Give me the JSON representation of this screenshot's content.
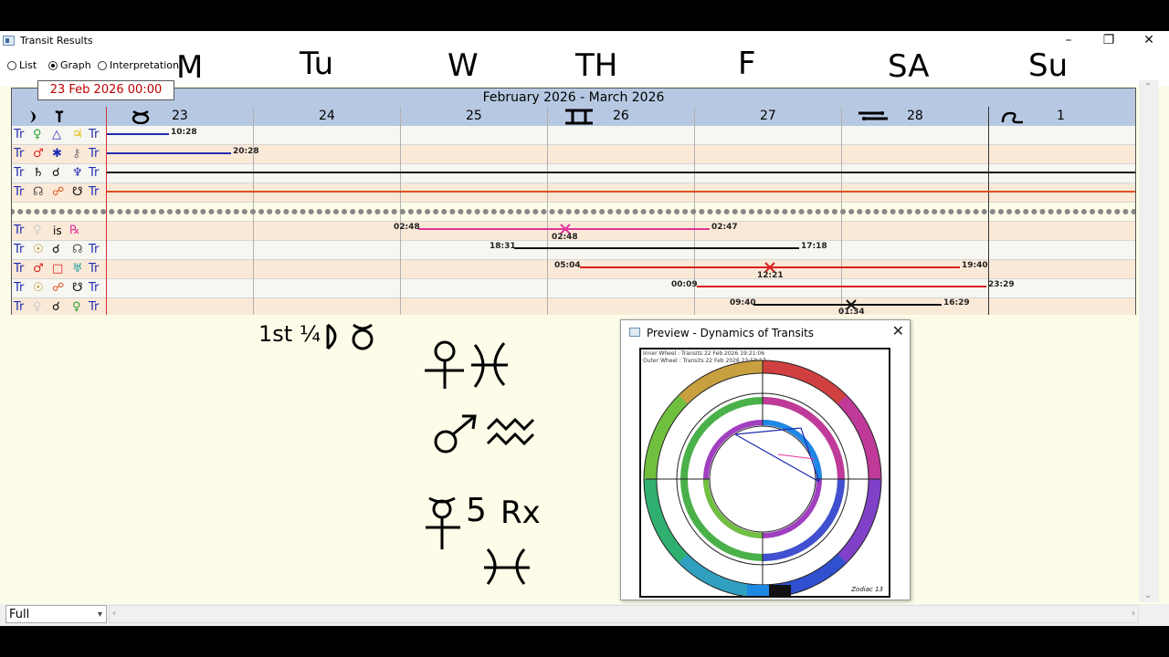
{
  "window": {
    "title": "Transit Results"
  },
  "view_options": [
    {
      "label": "List",
      "selected": false
    },
    {
      "label": "Graph",
      "selected": true
    },
    {
      "label": "Interpretation",
      "selected": false
    }
  ],
  "weekday_annotations": [
    "M",
    "Tu",
    "W",
    "TH",
    "F",
    "SA",
    "Su"
  ],
  "date_box": "23 Feb 2026 00:00",
  "graph": {
    "month_range": "February 2026 - March 2026",
    "days": [
      "23",
      "24",
      "25",
      "26",
      "27",
      "28",
      "1"
    ],
    "rows": [
      {
        "left": "Tr",
        "right": "Tr",
        "times": [
          "10:28"
        ]
      },
      {
        "left": "Tr",
        "right": "Tr",
        "times": [
          "20:28"
        ]
      },
      {
        "left": "Tr",
        "right": "Tr",
        "times": []
      },
      {
        "left": "Tr",
        "right": "Tr",
        "times": []
      },
      {
        "left": "",
        "right": "",
        "times": []
      },
      {
        "left": "Tr",
        "middle": "is",
        "right": "",
        "times": [
          "02:48",
          "02:48",
          "02:47"
        ]
      },
      {
        "left": "Tr",
        "right": "Tr",
        "times": [
          "18:31",
          "17:18"
        ]
      },
      {
        "left": "Tr",
        "right": "Tr",
        "times": [
          "05:04",
          "12:21",
          "19:40"
        ]
      },
      {
        "left": "Tr",
        "right": "Tr",
        "times": [
          "00:09",
          "23:29"
        ]
      },
      {
        "left": "Tr",
        "right": "Tr",
        "times": [
          "09:40",
          "01:34",
          "16:29"
        ]
      }
    ]
  },
  "handwriting": {
    "first_quarter": "1st ¼",
    "rx": "Rx"
  },
  "preview": {
    "title": "Preview - Dynamics of Transits",
    "inner_wheel": "Inner Wheel : Transits 22 Feb 2026 19:21:06",
    "outer_wheel": "Outer Wheel : Transits 22 Feb 2026 23:58:17",
    "footer": "Zodiac 13"
  },
  "statusbar": {
    "scale_option": "Full"
  },
  "colors": {
    "header_blue": "#b7c9e2",
    "date_red": "#c00000",
    "aspect_blue": "#1f2db0",
    "aspect_orange": "#e0501e",
    "aspect_pink": "#e0369a",
    "aspect_red": "#d92020"
  }
}
